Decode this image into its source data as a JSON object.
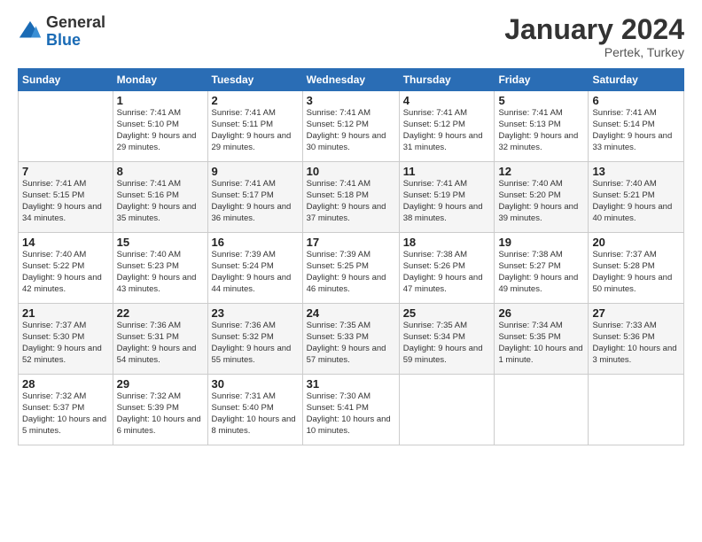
{
  "logo": {
    "general": "General",
    "blue": "Blue"
  },
  "header": {
    "month_title": "January 2024",
    "location": "Pertek, Turkey"
  },
  "days_of_week": [
    "Sunday",
    "Monday",
    "Tuesday",
    "Wednesday",
    "Thursday",
    "Friday",
    "Saturday"
  ],
  "weeks": [
    [
      {
        "day": "",
        "sunrise": "",
        "sunset": "",
        "daylight": ""
      },
      {
        "day": "1",
        "sunrise": "Sunrise: 7:41 AM",
        "sunset": "Sunset: 5:10 PM",
        "daylight": "Daylight: 9 hours and 29 minutes."
      },
      {
        "day": "2",
        "sunrise": "Sunrise: 7:41 AM",
        "sunset": "Sunset: 5:11 PM",
        "daylight": "Daylight: 9 hours and 29 minutes."
      },
      {
        "day": "3",
        "sunrise": "Sunrise: 7:41 AM",
        "sunset": "Sunset: 5:12 PM",
        "daylight": "Daylight: 9 hours and 30 minutes."
      },
      {
        "day": "4",
        "sunrise": "Sunrise: 7:41 AM",
        "sunset": "Sunset: 5:12 PM",
        "daylight": "Daylight: 9 hours and 31 minutes."
      },
      {
        "day": "5",
        "sunrise": "Sunrise: 7:41 AM",
        "sunset": "Sunset: 5:13 PM",
        "daylight": "Daylight: 9 hours and 32 minutes."
      },
      {
        "day": "6",
        "sunrise": "Sunrise: 7:41 AM",
        "sunset": "Sunset: 5:14 PM",
        "daylight": "Daylight: 9 hours and 33 minutes."
      }
    ],
    [
      {
        "day": "7",
        "sunrise": "Sunrise: 7:41 AM",
        "sunset": "Sunset: 5:15 PM",
        "daylight": "Daylight: 9 hours and 34 minutes."
      },
      {
        "day": "8",
        "sunrise": "Sunrise: 7:41 AM",
        "sunset": "Sunset: 5:16 PM",
        "daylight": "Daylight: 9 hours and 35 minutes."
      },
      {
        "day": "9",
        "sunrise": "Sunrise: 7:41 AM",
        "sunset": "Sunset: 5:17 PM",
        "daylight": "Daylight: 9 hours and 36 minutes."
      },
      {
        "day": "10",
        "sunrise": "Sunrise: 7:41 AM",
        "sunset": "Sunset: 5:18 PM",
        "daylight": "Daylight: 9 hours and 37 minutes."
      },
      {
        "day": "11",
        "sunrise": "Sunrise: 7:41 AM",
        "sunset": "Sunset: 5:19 PM",
        "daylight": "Daylight: 9 hours and 38 minutes."
      },
      {
        "day": "12",
        "sunrise": "Sunrise: 7:40 AM",
        "sunset": "Sunset: 5:20 PM",
        "daylight": "Daylight: 9 hours and 39 minutes."
      },
      {
        "day": "13",
        "sunrise": "Sunrise: 7:40 AM",
        "sunset": "Sunset: 5:21 PM",
        "daylight": "Daylight: 9 hours and 40 minutes."
      }
    ],
    [
      {
        "day": "14",
        "sunrise": "Sunrise: 7:40 AM",
        "sunset": "Sunset: 5:22 PM",
        "daylight": "Daylight: 9 hours and 42 minutes."
      },
      {
        "day": "15",
        "sunrise": "Sunrise: 7:40 AM",
        "sunset": "Sunset: 5:23 PM",
        "daylight": "Daylight: 9 hours and 43 minutes."
      },
      {
        "day": "16",
        "sunrise": "Sunrise: 7:39 AM",
        "sunset": "Sunset: 5:24 PM",
        "daylight": "Daylight: 9 hours and 44 minutes."
      },
      {
        "day": "17",
        "sunrise": "Sunrise: 7:39 AM",
        "sunset": "Sunset: 5:25 PM",
        "daylight": "Daylight: 9 hours and 46 minutes."
      },
      {
        "day": "18",
        "sunrise": "Sunrise: 7:38 AM",
        "sunset": "Sunset: 5:26 PM",
        "daylight": "Daylight: 9 hours and 47 minutes."
      },
      {
        "day": "19",
        "sunrise": "Sunrise: 7:38 AM",
        "sunset": "Sunset: 5:27 PM",
        "daylight": "Daylight: 9 hours and 49 minutes."
      },
      {
        "day": "20",
        "sunrise": "Sunrise: 7:37 AM",
        "sunset": "Sunset: 5:28 PM",
        "daylight": "Daylight: 9 hours and 50 minutes."
      }
    ],
    [
      {
        "day": "21",
        "sunrise": "Sunrise: 7:37 AM",
        "sunset": "Sunset: 5:30 PM",
        "daylight": "Daylight: 9 hours and 52 minutes."
      },
      {
        "day": "22",
        "sunrise": "Sunrise: 7:36 AM",
        "sunset": "Sunset: 5:31 PM",
        "daylight": "Daylight: 9 hours and 54 minutes."
      },
      {
        "day": "23",
        "sunrise": "Sunrise: 7:36 AM",
        "sunset": "Sunset: 5:32 PM",
        "daylight": "Daylight: 9 hours and 55 minutes."
      },
      {
        "day": "24",
        "sunrise": "Sunrise: 7:35 AM",
        "sunset": "Sunset: 5:33 PM",
        "daylight": "Daylight: 9 hours and 57 minutes."
      },
      {
        "day": "25",
        "sunrise": "Sunrise: 7:35 AM",
        "sunset": "Sunset: 5:34 PM",
        "daylight": "Daylight: 9 hours and 59 minutes."
      },
      {
        "day": "26",
        "sunrise": "Sunrise: 7:34 AM",
        "sunset": "Sunset: 5:35 PM",
        "daylight": "Daylight: 10 hours and 1 minute."
      },
      {
        "day": "27",
        "sunrise": "Sunrise: 7:33 AM",
        "sunset": "Sunset: 5:36 PM",
        "daylight": "Daylight: 10 hours and 3 minutes."
      }
    ],
    [
      {
        "day": "28",
        "sunrise": "Sunrise: 7:32 AM",
        "sunset": "Sunset: 5:37 PM",
        "daylight": "Daylight: 10 hours and 5 minutes."
      },
      {
        "day": "29",
        "sunrise": "Sunrise: 7:32 AM",
        "sunset": "Sunset: 5:39 PM",
        "daylight": "Daylight: 10 hours and 6 minutes."
      },
      {
        "day": "30",
        "sunrise": "Sunrise: 7:31 AM",
        "sunset": "Sunset: 5:40 PM",
        "daylight": "Daylight: 10 hours and 8 minutes."
      },
      {
        "day": "31",
        "sunrise": "Sunrise: 7:30 AM",
        "sunset": "Sunset: 5:41 PM",
        "daylight": "Daylight: 10 hours and 10 minutes."
      },
      {
        "day": "",
        "sunrise": "",
        "sunset": "",
        "daylight": ""
      },
      {
        "day": "",
        "sunrise": "",
        "sunset": "",
        "daylight": ""
      },
      {
        "day": "",
        "sunrise": "",
        "sunset": "",
        "daylight": ""
      }
    ]
  ]
}
